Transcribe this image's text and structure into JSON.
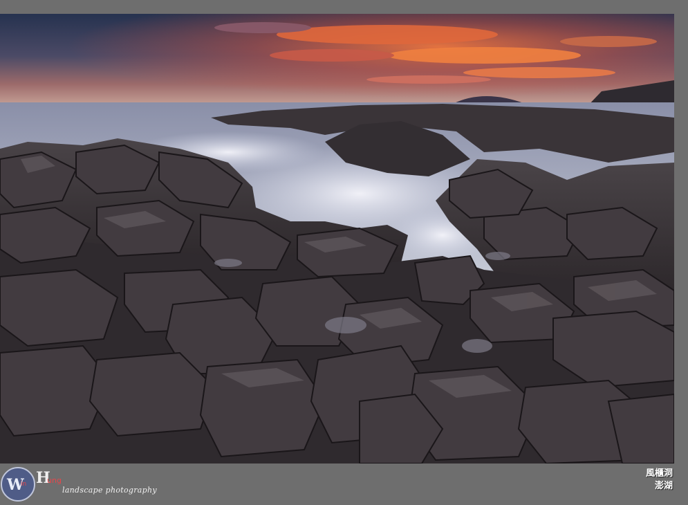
{
  "photo": {
    "alt_subject": "coastal basalt rocks at sunset",
    "colors": {
      "sky_top": "#2c3a5c",
      "sky_glow": "#e8603a",
      "sea": "#9aa6b8",
      "rock": "#3a3438",
      "frame": "#6e6e6e"
    }
  },
  "watermark": {
    "logo_letters": "Win Hung",
    "tagline": "landscape photography"
  },
  "caption": {
    "line1": "風櫃洞",
    "line2": "澎湖"
  }
}
